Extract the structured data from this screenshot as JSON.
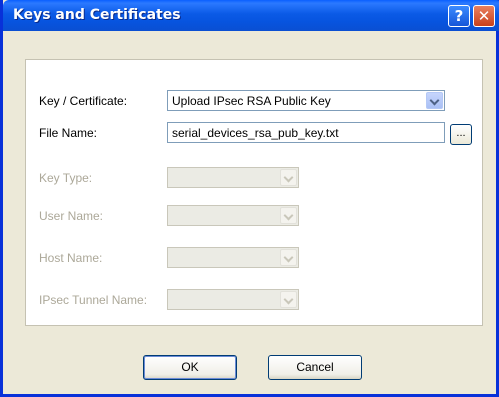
{
  "window": {
    "title": "Keys and Certificates",
    "help_glyph": "?",
    "close_glyph": "✕"
  },
  "form": {
    "key_cert_label": "Key / Certificate:",
    "key_cert_value": "Upload IPsec RSA Public Key",
    "file_name_label": "File Name:",
    "file_name_value": "serial_devices_rsa_pub_key.txt",
    "browse_label": "...",
    "key_type_label": "Key Type:",
    "user_name_label": "User Name:",
    "host_name_label": "Host Name:",
    "ipsec_tunnel_label": "IPsec Tunnel Name:"
  },
  "buttons": {
    "ok": "OK",
    "cancel": "Cancel"
  }
}
